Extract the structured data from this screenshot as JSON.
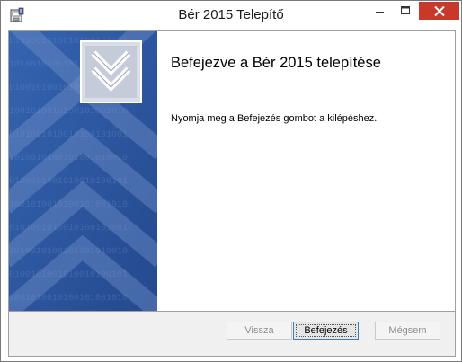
{
  "window": {
    "title": "Bér 2015 Telepítő",
    "controls": {
      "minimize_icon": "minimize-icon",
      "maximize_icon": "maximize-icon",
      "close_icon": "close-icon"
    },
    "app_icon": "installer-icon"
  },
  "banner": {
    "logo_icon": "double-chevron-down-icon",
    "background_color": "#2d59a3"
  },
  "content": {
    "heading": "Befejezve a Bér 2015 telepítése",
    "description": "Nyomja meg a Befejezés gombot a kilépéshez."
  },
  "buttons": {
    "back_label": "Vissza",
    "finish_label": "Befejezés",
    "cancel_label": "Mégsem"
  },
  "colors": {
    "close_button": "#c7392b",
    "footer": "#f0f0f0",
    "focus_border": "#3c7fb1"
  }
}
